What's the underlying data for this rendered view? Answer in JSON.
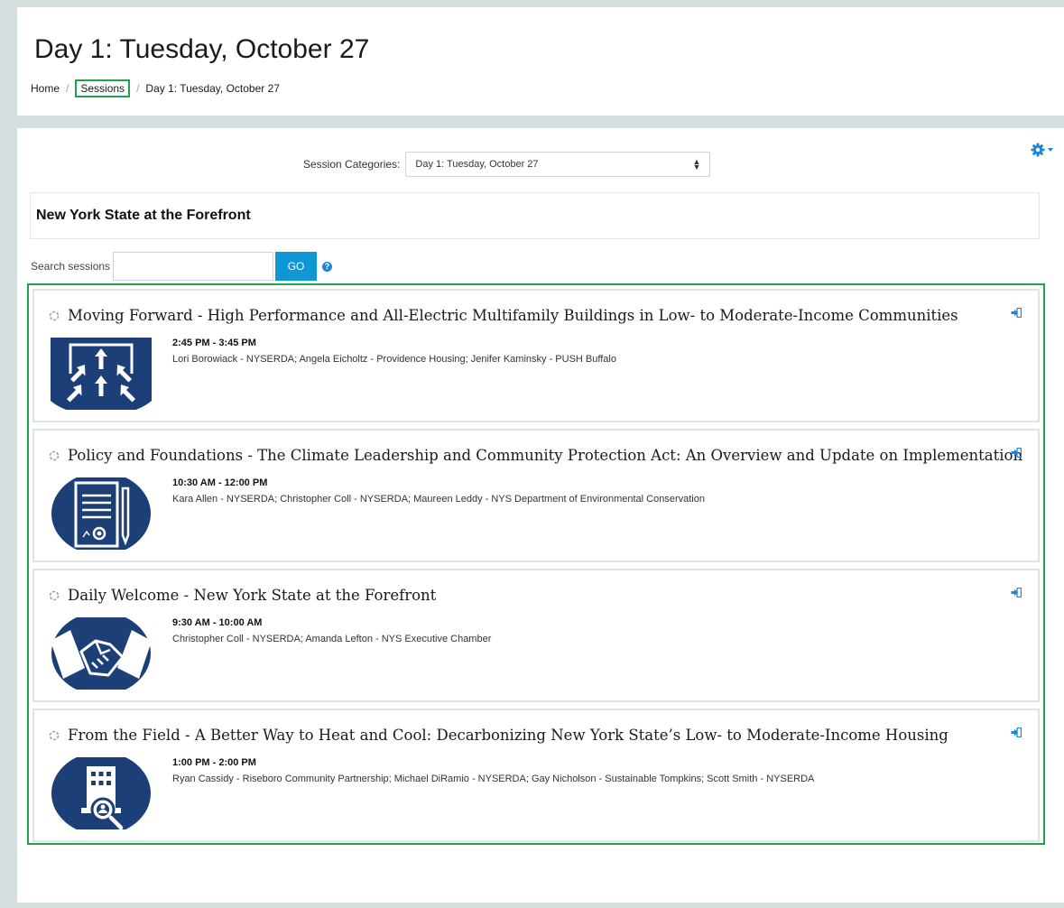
{
  "header": {
    "title": "Day 1: Tuesday, October 27",
    "breadcrumb": [
      {
        "label": "Home"
      },
      {
        "label": "Sessions"
      },
      {
        "label": "Day 1: Tuesday, October 27"
      }
    ]
  },
  "filters": {
    "categories_label": "Session Categories:",
    "selected_category": "Day 1: Tuesday, October 27"
  },
  "category_heading": "New York State at the Forefront",
  "search": {
    "label": "Search sessions",
    "value": "",
    "button_label": "GO"
  },
  "sessions": [
    {
      "title": "Moving Forward - High Performance and All-Electric Multifamily Buildings in Low- to Moderate-Income Communities",
      "time": "2:45 PM - 3:45 PM",
      "speakers": "Lori Borowiack - NYSERDA; Angela Eicholtz - Providence Housing; Jenifer Kaminsky - PUSH Buffalo",
      "icon": "arrows-up-icon"
    },
    {
      "title": "Policy and Foundations - The Climate Leadership and Community Protection Act: An Overview and Update on Implementation",
      "time": "10:30 AM - 12:00 PM",
      "speakers": "Kara Allen - NYSERDA; Christopher Coll - NYSERDA; Maureen Leddy - NYS Department of Environmental Conservation",
      "icon": "document-pen-icon"
    },
    {
      "title": "Daily Welcome - New York State at the Forefront",
      "time": "9:30 AM - 10:00 AM",
      "speakers": "Christopher Coll - NYSERDA; Amanda Lefton - NYS Executive Chamber",
      "icon": "handshake-icon"
    },
    {
      "title": "From the Field - A Better Way to Heat and Cool: Decarbonizing New York State’s Low- to Moderate-Income Housing",
      "time": "1:00 PM - 2:00 PM",
      "speakers": "Ryan Cassidy - Riseboro Community Partnership; Michael DiRamio - NYSERDA; Gay Nicholson - Sustainable Tompkins; Scott Smith - NYSERDA",
      "icon": "building-search-icon"
    }
  ],
  "colors": {
    "accent": "#0f96d6",
    "thumb_bg": "#1c3f78",
    "highlight": "#1ea44a"
  }
}
